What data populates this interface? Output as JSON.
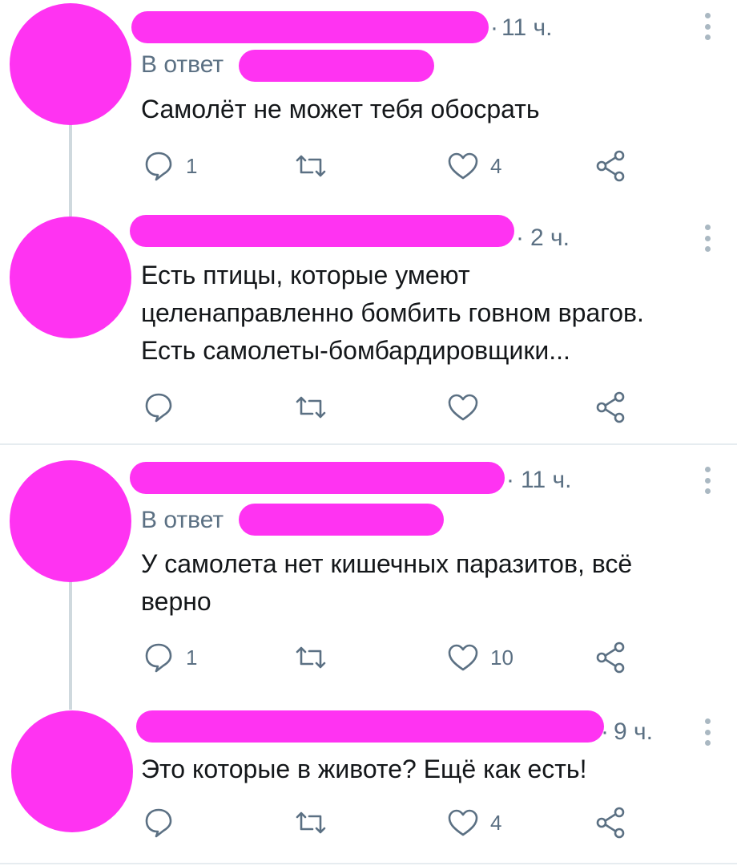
{
  "tweets": [
    {
      "time": "11 ч.",
      "reply_prefix": "В ответ",
      "lines": [
        "Самолёт не может тебя обосрать"
      ],
      "replies": "1",
      "retweets": "",
      "likes": "4"
    },
    {
      "time": "2 ч.",
      "reply_prefix": "",
      "lines": [
        "Есть птицы, которые умеют",
        "целенаправленно бомбить говном врагов.",
        "Есть самолеты-бомбардировщики..."
      ],
      "replies": "",
      "retweets": "",
      "likes": ""
    },
    {
      "time": "11 ч.",
      "reply_prefix": "В ответ",
      "lines": [
        "У самолета нет кишечных паразитов, всё",
        "верно"
      ],
      "replies": "1",
      "retweets": "",
      "likes": "10"
    },
    {
      "time": "9 ч.",
      "reply_prefix": "",
      "lines": [
        "Это которые в животе? Ещё как есть!"
      ],
      "replies": "",
      "retweets": "",
      "likes": "4"
    }
  ],
  "separator": "·",
  "colors": {
    "censor": "#ff33f2",
    "muted": "#5b7083",
    "thread_line": "#cfd9de",
    "divider": "#e6ecf0"
  },
  "icons": [
    "reply-icon",
    "retweet-icon",
    "like-icon",
    "share-icon",
    "more-options-icon"
  ]
}
